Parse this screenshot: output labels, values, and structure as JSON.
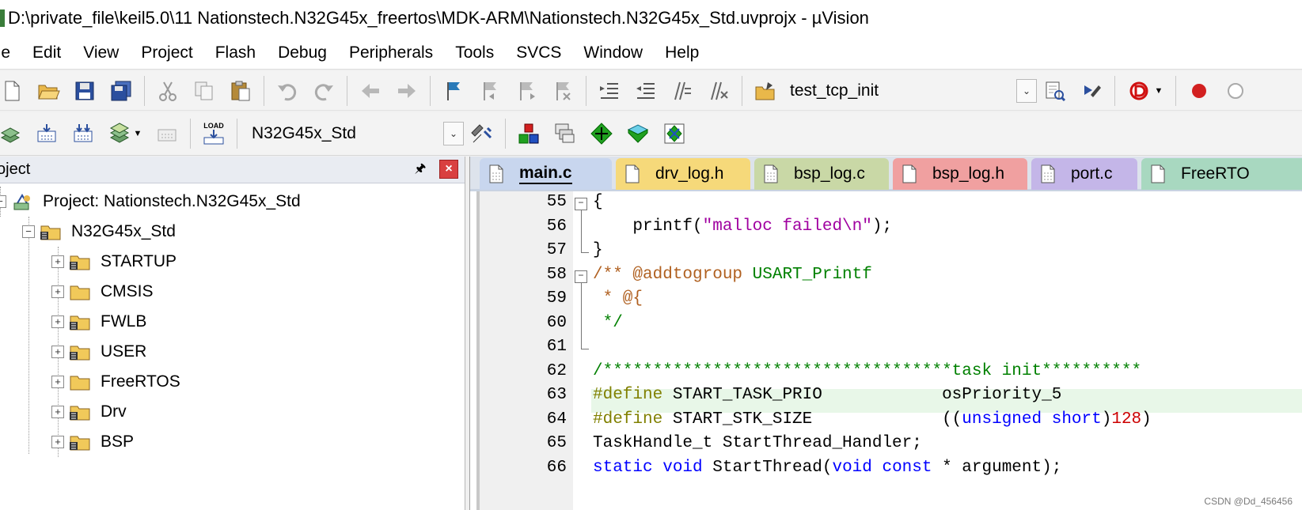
{
  "window": {
    "title": "D:\\private_file\\keil5.0\\11 Nationstech.N32G45x_freertos\\MDK-ARM\\Nationstech.N32G45x_Std.uvprojx - µVision"
  },
  "menu": [
    "ile",
    "Edit",
    "View",
    "Project",
    "Flash",
    "Debug",
    "Peripherals",
    "Tools",
    "SVCS",
    "Window",
    "Help"
  ],
  "toolbar1": {
    "find_combo_value": "test_tcp_init",
    "icons": [
      "new-file-icon",
      "open-folder-icon",
      "save-icon",
      "save-all-icon",
      "cut-icon",
      "copy-icon",
      "paste-icon",
      "undo-icon",
      "redo-icon",
      "nav-back-icon",
      "nav-forward-icon",
      "bookmark-set-icon",
      "bookmark-prev-icon",
      "bookmark-next-icon",
      "bookmark-clear-icon",
      "indent-icon",
      "unindent-icon",
      "comment-icon",
      "uncomment-icon",
      "find-in-files-icon",
      "find-icon",
      "incremental-find-icon",
      "debug-start-icon",
      "breakpoint-icon",
      "breakpoint-disable-icon"
    ]
  },
  "toolbar2": {
    "target_combo_value": "N32G45x_Std",
    "icons": [
      "translate-icon",
      "build-icon",
      "rebuild-icon",
      "batch-build-icon",
      "stop-build-icon",
      "download-icon",
      "target-options-icon",
      "manage-components-icon",
      "select-packs-icon",
      "pack-installer-icon",
      "run-time-env-icon",
      "software-packs-icon"
    ],
    "load_label": "LOAD"
  },
  "project_panel": {
    "title": "oject",
    "root": "Project: Nationstech.N32G45x_Std",
    "target": "N32G45x_Std",
    "groups": [
      "STARTUP",
      "CMSIS",
      "FWLB",
      "USER",
      "FreeRTOS",
      "Drv",
      "BSP"
    ]
  },
  "editor": {
    "tabs": [
      {
        "label": "main.c",
        "color": "#c8d6ee",
        "active": true
      },
      {
        "label": "drv_log.h",
        "color": "#f6d97a",
        "active": false
      },
      {
        "label": "bsp_log.c",
        "color": "#c9d8a6",
        "active": false
      },
      {
        "label": "bsp_log.h",
        "color": "#f0a0a0",
        "active": false
      },
      {
        "label": "port.c",
        "color": "#c4b6e8",
        "active": false
      },
      {
        "label": "FreeRTO",
        "color": "#a8d8c0",
        "active": false
      }
    ],
    "lines": [
      {
        "n": "55",
        "segs": [
          [
            "",
            "{"
          ]
        ]
      },
      {
        "n": "56",
        "segs": [
          [
            "",
            "    printf("
          ],
          [
            "str",
            "\"malloc failed\\n\""
          ],
          [
            "",
            ");"
          ]
        ]
      },
      {
        "n": "57",
        "segs": [
          [
            "",
            "}"
          ]
        ]
      },
      {
        "n": "58",
        "segs": [
          [
            "cmdoc",
            "/** @addtogroup "
          ],
          [
            "cm",
            "USART_Printf"
          ]
        ]
      },
      {
        "n": "59",
        "segs": [
          [
            "cmdoc",
            " * @{"
          ]
        ]
      },
      {
        "n": "60",
        "segs": [
          [
            "cm",
            " */"
          ]
        ]
      },
      {
        "n": "61",
        "segs": [
          [
            "",
            ""
          ]
        ]
      },
      {
        "n": "62",
        "segs": [
          [
            "cm",
            "/***********************************task init**********"
          ]
        ]
      },
      {
        "n": "63",
        "segs": [
          [
            "pp",
            "#define "
          ],
          [
            "",
            "START_TASK_PRIO            osPriority_5"
          ]
        ]
      },
      {
        "n": "64",
        "segs": [
          [
            "pp",
            "#define "
          ],
          [
            "",
            "START_STK_SIZE             (("
          ],
          [
            "kw",
            "unsigned short"
          ],
          [
            "",
            ")"
          ],
          [
            "num",
            "128"
          ],
          [
            "",
            ")"
          ]
        ]
      },
      {
        "n": "65",
        "segs": [
          [
            "",
            "TaskHandle_t StartThread_Handler;"
          ]
        ]
      },
      {
        "n": "66",
        "segs": [
          [
            "kw",
            "static void "
          ],
          [
            "",
            "StartThread("
          ],
          [
            "kw",
            "void const "
          ],
          [
            "",
            "* argument);"
          ]
        ]
      }
    ]
  },
  "watermark": "CSDN @Dd_456456"
}
